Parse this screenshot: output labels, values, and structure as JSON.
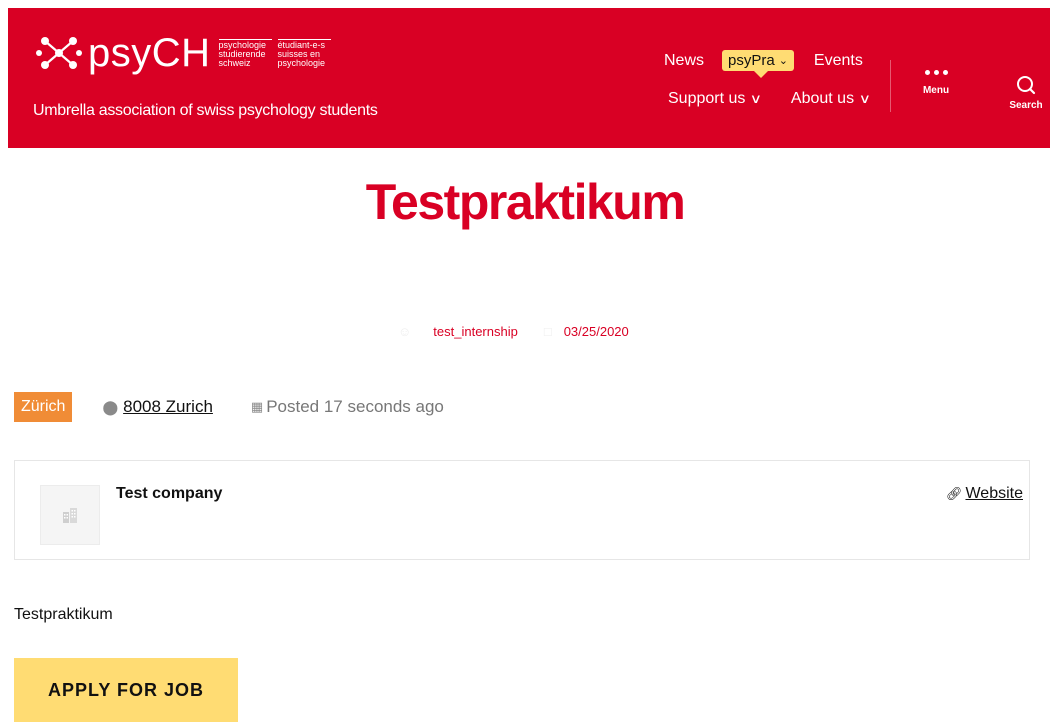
{
  "header": {
    "logo": {
      "name": "psyCH",
      "sub_col1": [
        "psychologie",
        "studierende",
        "schweiz"
      ],
      "sub_col2": [
        "étudiant-e-s",
        "suisses en",
        "psychologie"
      ]
    },
    "tagline": "Umbrella association of swiss psychology students",
    "nav": {
      "news": "News",
      "psypra": "psyPra",
      "events": "Events",
      "support_us": "Support us",
      "about_us": "About us"
    },
    "menu_label": "Menu",
    "search_label": "Search"
  },
  "page": {
    "title": "Testpraktikum",
    "meta": {
      "author": "test_internship",
      "date": "03/25/2020"
    }
  },
  "job": {
    "location_badge": "Zürich",
    "location": "8008 Zurich",
    "posted": "Posted 17 seconds ago",
    "company_name": "Test company",
    "website_label": "Website",
    "description": "Testpraktikum",
    "apply_label": "APPLY FOR JOB"
  },
  "colors": {
    "brand_red": "#d90024",
    "highlight_yellow": "#ffdc73",
    "badge_orange": "#f08c36"
  }
}
